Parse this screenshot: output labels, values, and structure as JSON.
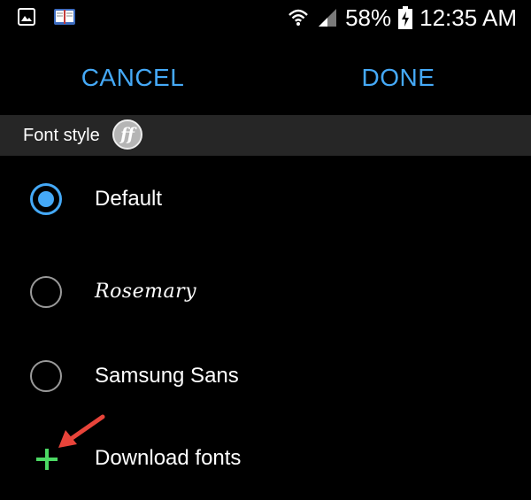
{
  "status_bar": {
    "battery_percent": "58%",
    "time": "12:35 AM",
    "icons": [
      "gallery-icon",
      "book-icon",
      "wifi-icon",
      "signal-icon",
      "battery-charging-icon"
    ]
  },
  "actions": {
    "cancel_label": "CANCEL",
    "done_label": "DONE"
  },
  "header": {
    "title": "Font style",
    "badge_text": "ff"
  },
  "options": [
    {
      "label": "Default",
      "selected": true
    },
    {
      "label": "Rosemary",
      "selected": false
    },
    {
      "label": "Samsung Sans",
      "selected": false
    }
  ],
  "download": {
    "label": "Download fonts"
  },
  "colors": {
    "accent": "#45a9f7",
    "plus": "#4cd964",
    "arrow": "#e8443a",
    "header_bg": "#262626"
  }
}
